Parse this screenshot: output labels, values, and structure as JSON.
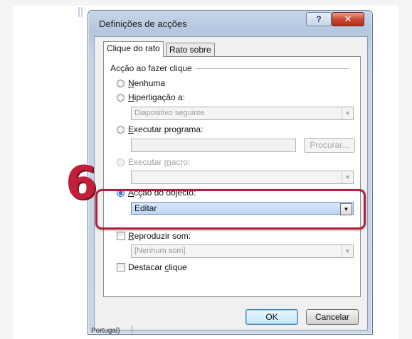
{
  "window": {
    "title": "Definições de acções",
    "help_glyph": "?",
    "close_glyph": "✕"
  },
  "tabs": [
    {
      "label": "Clique do rato",
      "active": true
    },
    {
      "label": "Rato sobre",
      "active": false
    }
  ],
  "group": {
    "label": "Acção ao fazer clique"
  },
  "options": {
    "none": {
      "label_u": "N",
      "label_rest": "enhuma",
      "checked": false
    },
    "hyperlink": {
      "label_u": "H",
      "label_rest": "iperligação a:",
      "checked": false,
      "value": "Diapositivo seguinte"
    },
    "run_program": {
      "label_u": "E",
      "label_rest": "xecutar programa:",
      "checked": false,
      "value": "",
      "browse_label": "Procurar..."
    },
    "run_macro": {
      "label_pre": "Executar ",
      "label_u": "m",
      "label_rest": "acro:",
      "checked": false,
      "disabled": true,
      "value": ""
    },
    "object_action": {
      "label_u": "A",
      "label_rest": "cção do objecto:",
      "checked": true,
      "value": "Editar"
    }
  },
  "sound": {
    "label_u": "R",
    "label_rest": "eproduzir som:",
    "checked": false,
    "value": "[Nenhum som]"
  },
  "highlight_click": {
    "label_pre": "Destacar ",
    "label_u": "c",
    "label_rest": "lique",
    "checked": false
  },
  "buttons": {
    "ok": "OK",
    "cancel": "Cancelar"
  },
  "annotation": {
    "step_number": "6",
    "color": "#c21f3a"
  },
  "statusbar": {
    "language": "Portugal)"
  },
  "icons": {
    "dropdown_arrow": "▼"
  }
}
